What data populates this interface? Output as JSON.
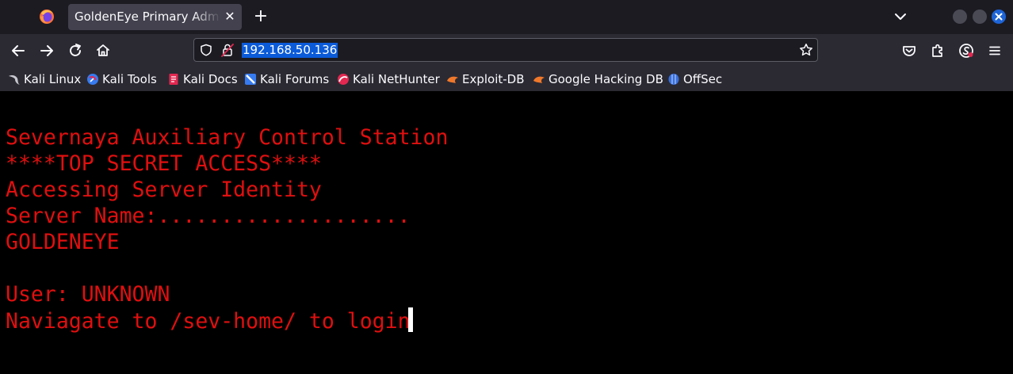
{
  "browser": {
    "tab": {
      "title": "GoldenEye Primary Admin Server"
    },
    "address_bar": {
      "url": "192.168.50.136"
    },
    "icons": {
      "firefox": "firefox-icon",
      "tab_close": "close-icon",
      "new_tab": "plus-icon",
      "tab_list": "chevron-down-icon",
      "back": "back-arrow-icon",
      "forward": "forward-arrow-icon",
      "reload": "reload-icon",
      "home": "home-icon",
      "shield": "shield-icon",
      "lock": "lock-icon",
      "star": "star-icon",
      "pocket": "pocket-icon",
      "extensions": "puzzle-icon",
      "account": "account-icon",
      "menu": "hamburger-menu-icon"
    },
    "tab_close_glyph": "✕",
    "new_tab_glyph": "+"
  },
  "bookmarks": [
    {
      "label": "Kali Linux",
      "icon": "kali-dragon-icon"
    },
    {
      "label": "Kali Tools",
      "icon": "kali-tools-icon"
    },
    {
      "label": "Kali Docs",
      "icon": "kali-docs-icon"
    },
    {
      "label": "Kali Forums",
      "icon": "kali-forums-icon"
    },
    {
      "label": "Kali NetHunter",
      "icon": "nethunter-icon"
    },
    {
      "label": "Exploit-DB",
      "icon": "exploit-db-icon"
    },
    {
      "label": "Google Hacking DB",
      "icon": "ghdb-icon"
    },
    {
      "label": "OffSec",
      "icon": "offsec-icon"
    }
  ],
  "page": {
    "lines": [
      "Severnaya Auxiliary Control Station",
      "****TOP SECRET ACCESS****",
      "Accessing Server Identity",
      "Server Name:....................",
      "GOLDENEYE",
      "",
      "User: UNKNOWN",
      "Naviagate to /sev-home/ to login"
    ]
  },
  "colors": {
    "terminal_text": "#e00f0f",
    "page_background": "#000000",
    "toolbar_background": "#2b2a33",
    "tabstrip_background": "#1c1b22",
    "url_selection": "#0b5bd9",
    "window_close_button": "#1d64d8"
  }
}
